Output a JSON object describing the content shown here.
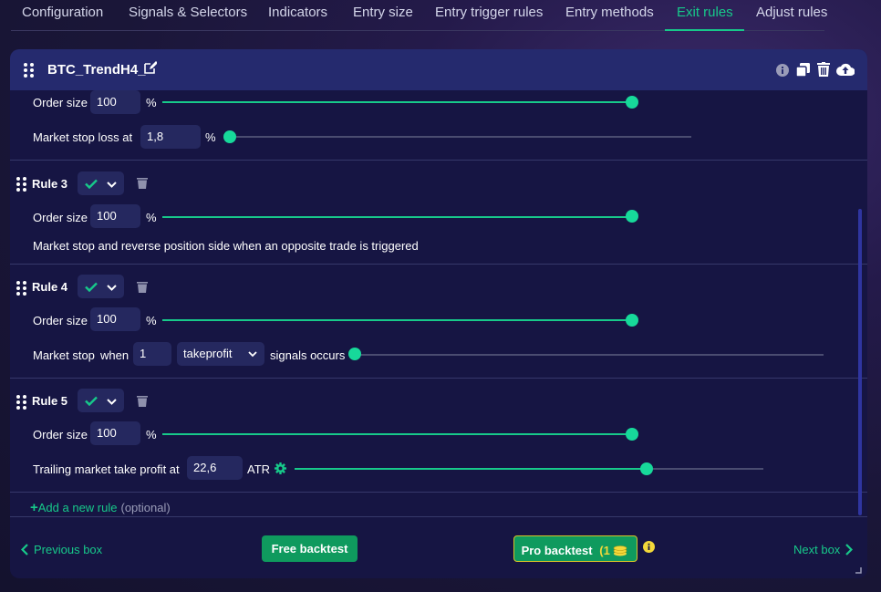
{
  "tabs": [
    {
      "label": "Configuration",
      "active": false
    },
    {
      "label": "Signals & Selectors",
      "active": false
    },
    {
      "label": "Indicators",
      "active": false
    },
    {
      "label": "Entry size",
      "active": false
    },
    {
      "label": "Entry trigger rules",
      "active": false
    },
    {
      "label": "Entry methods",
      "active": false
    },
    {
      "label": "Exit rules",
      "active": true
    },
    {
      "label": "Adjust rules",
      "active": false
    }
  ],
  "header": {
    "strategy_name": "BTC_TrendH4_",
    "icons": [
      "drag-handle-icon",
      "edit-icon",
      "info-icon",
      "copy-icon",
      "trash-icon",
      "cloud-upload-icon"
    ]
  },
  "rule2_partial": {
    "order_size_label": "Order size",
    "order_size_value": "100",
    "order_size_unit": "%",
    "order_size_level": 1.0,
    "stop_label": "Market stop loss at",
    "stop_value": "1,8",
    "stop_unit": "%",
    "stop_level": 0.0
  },
  "rules": [
    {
      "title": "Rule 3",
      "order_size_label": "Order size",
      "order_size_value": "100",
      "order_size_unit": "%",
      "order_size_level": 1.0,
      "description": "Market stop and reverse position side when an opposite trade is triggered"
    },
    {
      "title": "Rule 4",
      "order_size_label": "Order size",
      "order_size_value": "100",
      "order_size_unit": "%",
      "order_size_level": 1.0,
      "stop_label": "Market stop",
      "when_label": "when",
      "count_value": "1",
      "signal_select": "takeprofit",
      "signals_label": "signals occurs",
      "signal_level": 0.0
    },
    {
      "title": "Rule 5",
      "order_size_label": "Order size",
      "order_size_value": "100",
      "order_size_unit": "%",
      "order_size_level": 1.0,
      "trailing_label": "Trailing market take profit at",
      "trailing_value": "22,6",
      "trailing_unit": "ATR",
      "trailing_level": 0.75
    }
  ],
  "add_rule": {
    "label": "Add a new rule",
    "optional": "(optional)"
  },
  "footer": {
    "previous": "Previous box",
    "free_backtest": "Free backtest",
    "pro_backtest": "Pro backtest",
    "pro_credits": "(1",
    "next": "Next box"
  },
  "colors": {
    "accent": "#17c98a",
    "panel": "#161543",
    "header": "#252a6e",
    "input": "#25285f",
    "gold": "#f3d83a"
  }
}
